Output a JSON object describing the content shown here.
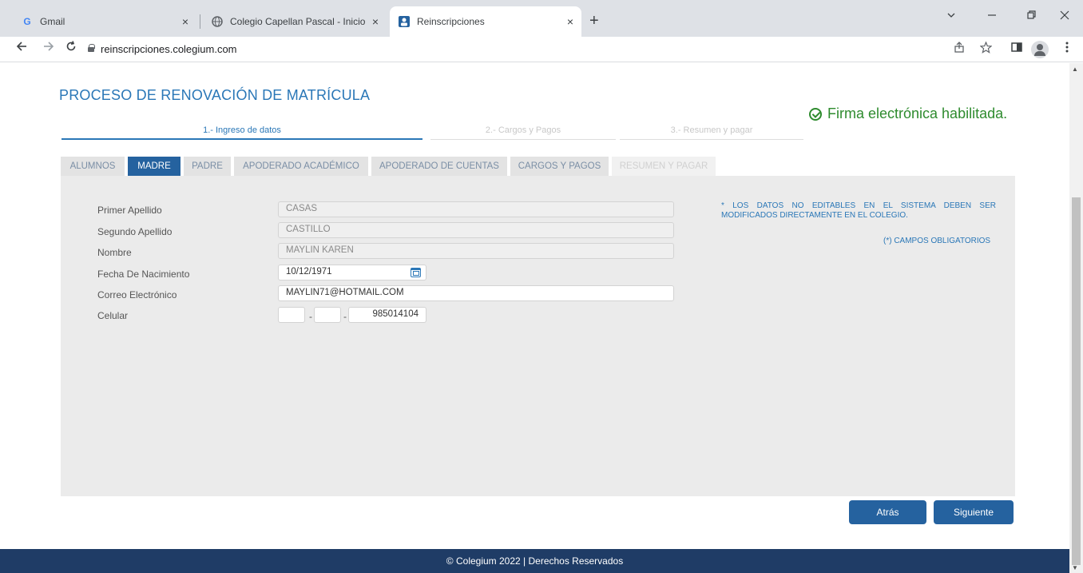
{
  "browser": {
    "tabs": [
      {
        "title": "Gmail",
        "favicon": "G"
      },
      {
        "title": "Colegio Capellan Pascal - Inicio S",
        "favicon": "globe-icon"
      },
      {
        "title": "Reinscripciones",
        "favicon": "reinscripciones-icon"
      }
    ],
    "url": "reinscripciones.colegium.com",
    "close_glyph": "×",
    "newtab_glyph": "+"
  },
  "page": {
    "title": "PROCESO DE RENOVACIÓN DE MATRÍCULA",
    "steps": [
      "1.- Ingreso de datos",
      "2.- Cargos y Pagos",
      "3.- Resumen y pagar"
    ],
    "firma": "Firma electrónica habilitada.",
    "tabs": [
      "ALUMNOS",
      "MADRE",
      "PADRE",
      "APODERADO ACADÉMICO",
      "APODERADO DE CUENTAS",
      "CARGOS Y PAGOS",
      "RESUMEN Y PAGAR"
    ],
    "active_tab": "MADRE",
    "form": {
      "primer_apellido": {
        "label": "Primer Apellido",
        "value": "CASAS"
      },
      "segundo_apellido": {
        "label": "Segundo Apellido",
        "value": "CASTILLO"
      },
      "nombre": {
        "label": "Nombre",
        "value": "MAYLIN KAREN"
      },
      "fecha": {
        "label": "Fecha De Nacimiento",
        "value": "10/12/1971"
      },
      "correo": {
        "label": "Correo Electrónico",
        "value": "MAYLIN71@HOTMAIL.COM"
      },
      "celular": {
        "label": "Celular",
        "part1": "",
        "part2": "",
        "number": "985014104",
        "separator": "-"
      }
    },
    "notice": "* LOS DATOS NO EDITABLES EN EL SISTEMA DEBEN SER MODIFICADOS DIRECTAMENTE EN EL COLEGIO.",
    "obligatorios": "(*) CAMPOS OBLIGATORIOS",
    "buttons": {
      "back": "Atrás",
      "next": "Siguiente"
    },
    "footer": "© Colegium 2022 | Derechos Reservados"
  },
  "colors": {
    "primary": "#25629f",
    "link": "#2a77b7",
    "success": "#2e8b2e",
    "footer": "#1f3c66"
  }
}
